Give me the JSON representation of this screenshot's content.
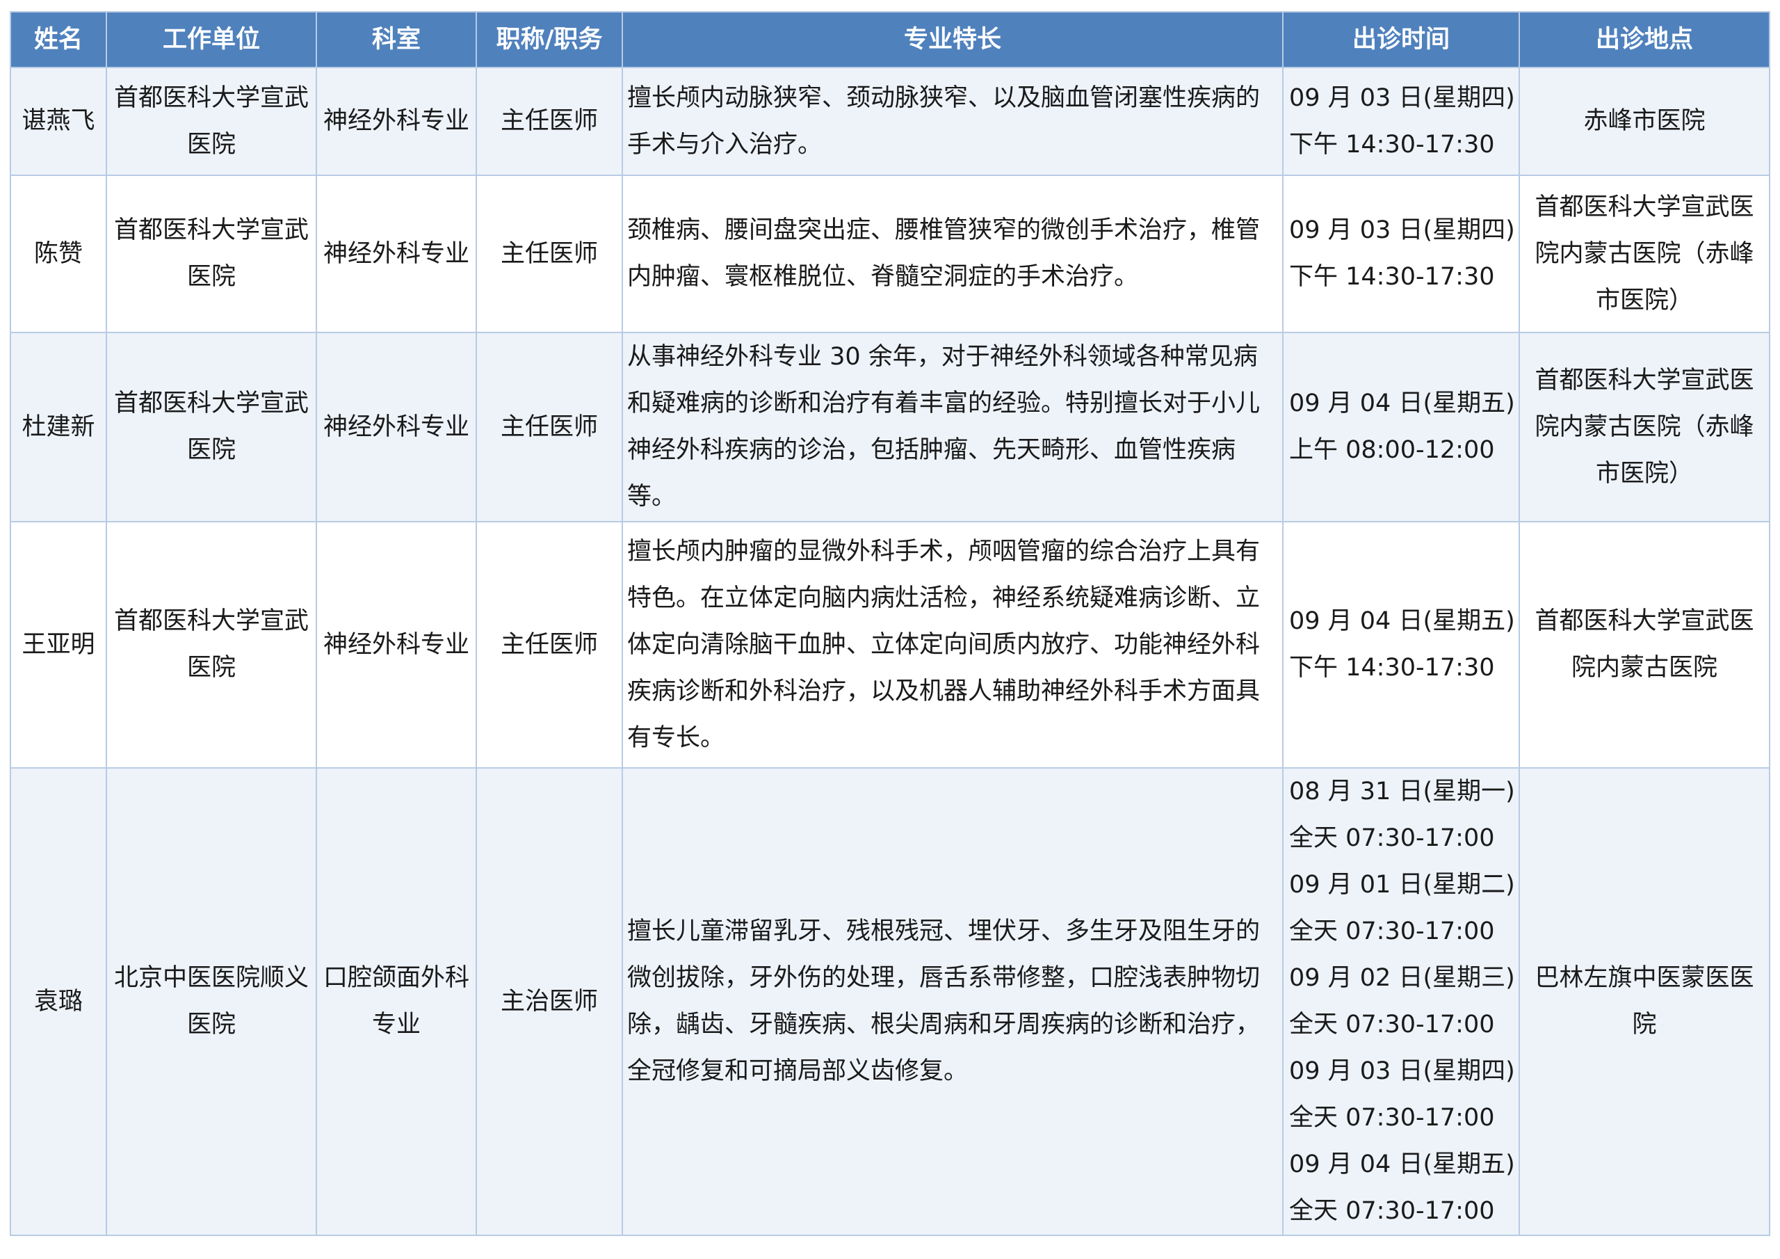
{
  "table": {
    "headers": [
      "姓名",
      "工作单位",
      "科室",
      "职称/职务",
      "专业特长",
      "出诊时间",
      "出诊地点"
    ],
    "rows": [
      {
        "name": "谌燕飞",
        "unit": "首都医科大学宣武医院",
        "department": "神经外科专业",
        "title": "主任医师",
        "expertise": "擅长颅内动脉狭窄、颈动脉狭窄、以及脑血管闭塞性疾病的手术与介入治疗。",
        "time": [
          "09 月 03 日(星期四)",
          "下午 14:30-17:30"
        ],
        "location": "赤峰市医院"
      },
      {
        "name": "陈赞",
        "unit": "首都医科大学宣武医院",
        "department": "神经外科专业",
        "title": "主任医师",
        "expertise": "颈椎病、腰间盘突出症、腰椎管狭窄的微创手术治疗，椎管内肿瘤、寰枢椎脱位、脊髓空洞症的手术治疗。",
        "time": [
          "09 月 03 日(星期四)",
          "下午 14:30-17:30"
        ],
        "location": "首都医科大学宣武医院内蒙古医院（赤峰市医院）"
      },
      {
        "name": "杜建新",
        "unit": "首都医科大学宣武医院",
        "department": "神经外科专业",
        "title": "主任医师",
        "expertise": "从事神经外科专业 30 余年，对于神经外科领域各种常见病和疑难病的诊断和治疗有着丰富的经验。特别擅长对于小儿神经外科疾病的诊治，包括肿瘤、先天畸形、血管性疾病等。",
        "time": [
          "09 月 04 日(星期五)",
          "上午 08:00-12:00"
        ],
        "location": "首都医科大学宣武医院内蒙古医院（赤峰市医院）"
      },
      {
        "name": "王亚明",
        "unit": "首都医科大学宣武医院",
        "department": "神经外科专业",
        "title": "主任医师",
        "expertise": "擅长颅内肿瘤的显微外科手术，颅咽管瘤的综合治疗上具有特色。在立体定向脑内病灶活检，神经系统疑难病诊断、立体定向清除脑干血肿、立体定向间质内放疗、功能神经外科疾病诊断和外科治疗，以及机器人辅助神经外科手术方面具有专长。",
        "time": [
          "09 月 04 日(星期五)",
          "下午 14:30-17:30"
        ],
        "location": "首都医科大学宣武医院内蒙古医院"
      },
      {
        "name": "袁璐",
        "unit": "北京中医医院顺义医院",
        "department": "口腔颌面外科专业",
        "title": "主治医师",
        "expertise": "擅长儿童滞留乳牙、残根残冠、埋伏牙、多生牙及阻生牙的微创拔除，牙外伤的处理，唇舌系带修整，口腔浅表肿物切除，龋齿、牙髓疾病、根尖周病和牙周疾病的诊断和治疗，全冠修复和可摘局部义齿修复。",
        "time": [
          "08 月 31 日(星期一)",
          "全天 07:30-17:00",
          "09 月 01 日(星期二)",
          "全天 07:30-17:00",
          "09 月 02 日(星期三)",
          "全天 07:30-17:00",
          "09 月 03 日(星期四)",
          "全天 07:30-17:00",
          "09 月 04 日(星期五)",
          "全天 07:30-17:00"
        ],
        "location": "巴林左旗中医蒙医医院"
      }
    ]
  }
}
